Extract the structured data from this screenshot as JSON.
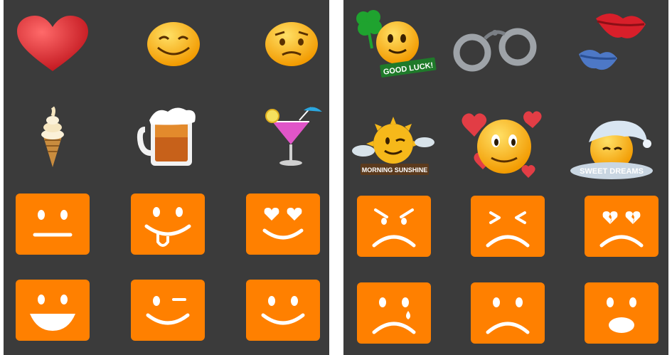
{
  "colors": {
    "panel_bg": "#3b3b3b",
    "tile_orange": "#ff8000",
    "face_white": "#ffffff"
  },
  "left_panel": {
    "emoji_row_1": [
      {
        "name": "red-heart-icon"
      },
      {
        "name": "smiling-face-icon"
      },
      {
        "name": "worried-face-icon"
      }
    ],
    "emoji_row_2": [
      {
        "name": "ice-cream-cone-icon"
      },
      {
        "name": "beer-mug-icon"
      },
      {
        "name": "cocktail-glass-icon"
      }
    ],
    "tile_rows": [
      [
        "neutral-face",
        "tongue-out-face",
        "heart-eyes-face"
      ],
      [
        "big-grin-face",
        "wink-face",
        "smile-face"
      ]
    ]
  },
  "right_panel": {
    "sticker_row_1": [
      {
        "name": "good-luck-sticker",
        "caption": "GOOD LUCK!"
      },
      {
        "name": "handcuffs-icon",
        "caption": ""
      },
      {
        "name": "kiss-lips-icon",
        "caption": ""
      }
    ],
    "sticker_row_2": [
      {
        "name": "morning-sunshine-sticker",
        "caption": "MORNING SUNSHINE"
      },
      {
        "name": "love-hearts-face-icon",
        "caption": ""
      },
      {
        "name": "sweet-dreams-sticker",
        "caption": "SWEET DREAMS"
      }
    ],
    "tile_rows": [
      [
        "angry-face",
        "squint-frown-face",
        "broken-heart-face"
      ],
      [
        "crying-face",
        "sad-face",
        "surprised-face"
      ]
    ]
  }
}
